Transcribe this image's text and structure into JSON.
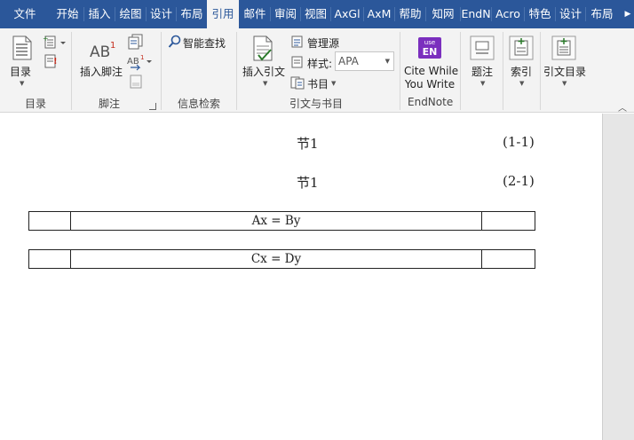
{
  "tabs": [
    {
      "label": "文件"
    },
    {
      "label": "开始"
    },
    {
      "label": "插入"
    },
    {
      "label": "绘图"
    },
    {
      "label": "设计"
    },
    {
      "label": "布局"
    },
    {
      "label": "引用"
    },
    {
      "label": "邮件"
    },
    {
      "label": "审阅"
    },
    {
      "label": "视图"
    },
    {
      "label": "AxGl"
    },
    {
      "label": "AxM"
    },
    {
      "label": "帮助"
    },
    {
      "label": "知网"
    },
    {
      "label": "EndN"
    },
    {
      "label": "Acro"
    },
    {
      "label": "特色"
    },
    {
      "label": "设计"
    },
    {
      "label": "布局"
    }
  ],
  "active_tab_index": 6,
  "ribbon": {
    "toc": {
      "button_label": "目录",
      "group_label": "目录"
    },
    "footnotes": {
      "insert_label": "插入脚注",
      "ab_text": "AB",
      "ab_sup": "1",
      "small_ab": "AB",
      "small_sup": "1",
      "group_label": "脚注"
    },
    "research": {
      "smart_lookup_label": "智能查找",
      "group_label": "信息检索"
    },
    "citations": {
      "insert_citation_label": "插入引文",
      "manage_sources_label": "管理源",
      "style_label": "样式:",
      "style_value": "APA",
      "bibliography_label": "书目",
      "group_label": "引文与书目"
    },
    "endnote": {
      "icon_top": "use",
      "icon_main": "EN",
      "line1": "Cite While",
      "line2": "You Write",
      "group_label": "EndNote"
    },
    "captions": {
      "insert_caption_label": "题注"
    },
    "index": {
      "label": "索引"
    },
    "toa": {
      "label": "引文目录"
    }
  },
  "document": {
    "equations": [
      {
        "text": "节1",
        "number": "(1-1)"
      },
      {
        "text": "节1",
        "number": "(2-1)"
      }
    ],
    "tables": [
      {
        "cells": [
          "",
          "Ax = By",
          ""
        ]
      },
      {
        "cells": [
          "",
          "Cx = Dy",
          ""
        ]
      }
    ]
  },
  "colors": {
    "tab_bar": "#2b579a",
    "ribbon_bg": "#f3f3f3",
    "endnote_accent": "#7b2fbe"
  }
}
